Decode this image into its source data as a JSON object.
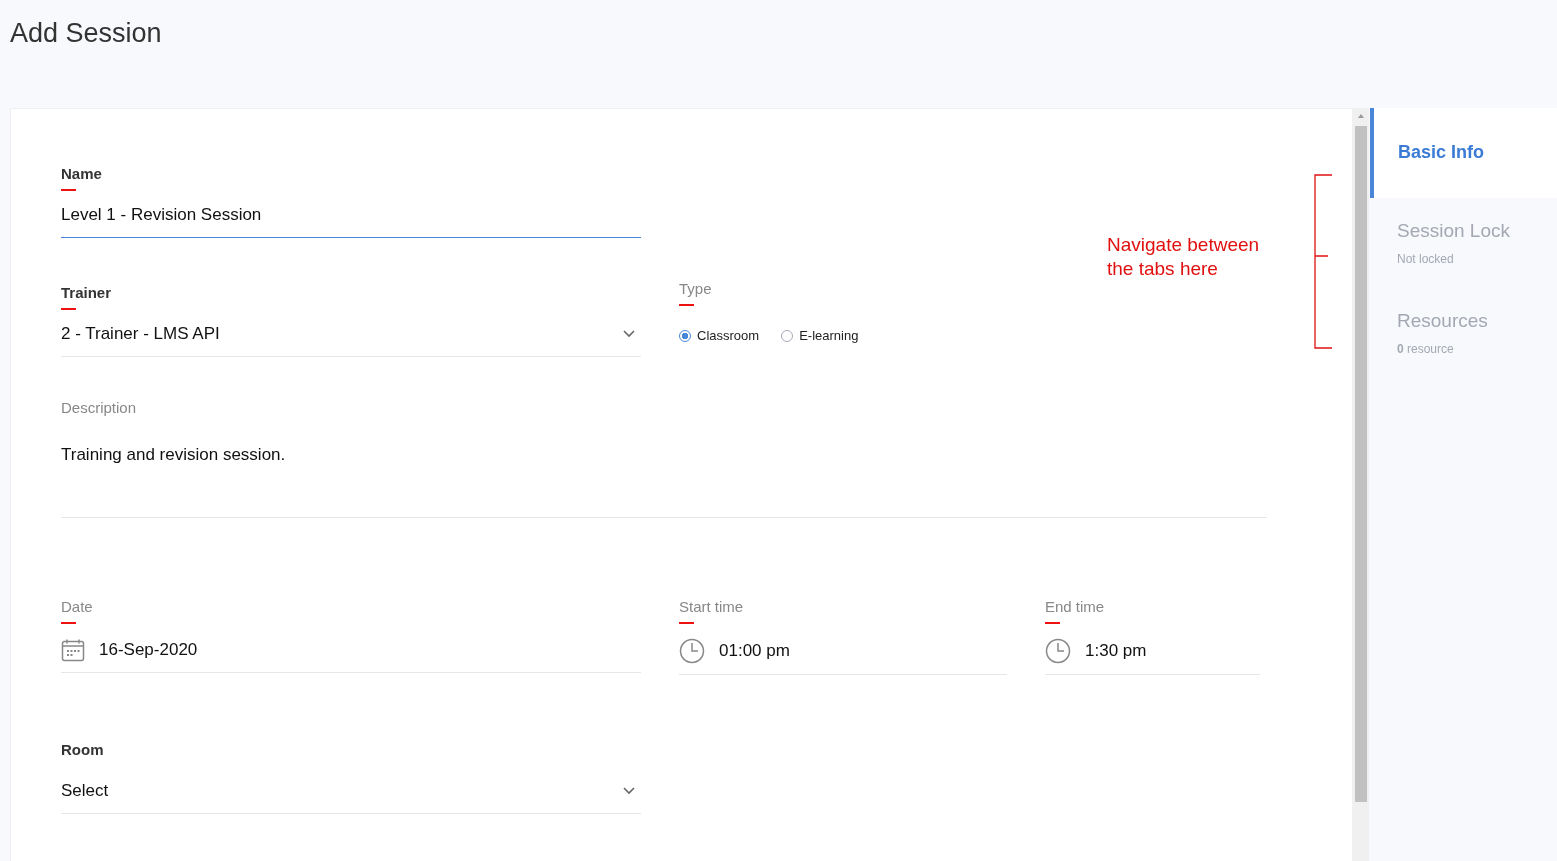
{
  "page": {
    "title": "Add Session"
  },
  "form": {
    "name": {
      "label": "Name",
      "bold": true,
      "required": true,
      "value": "Level 1 - Revision Session",
      "focused": true
    },
    "trainer": {
      "label": "Trainer",
      "bold": true,
      "required": true,
      "value": "2 - Trainer - LMS API"
    },
    "type": {
      "label": "Type",
      "bold": false,
      "required": true,
      "options": [
        {
          "label": "Classroom",
          "selected": true
        },
        {
          "label": "E-learning",
          "selected": false
        }
      ]
    },
    "description": {
      "label": "Description",
      "bold": false,
      "required": false,
      "value": "Training and revision session."
    },
    "date": {
      "label": "Date",
      "bold": false,
      "required": true,
      "value": "16-Sep-2020"
    },
    "start_time": {
      "label": "Start time",
      "bold": false,
      "required": true,
      "value": "01:00 pm"
    },
    "end_time": {
      "label": "End time",
      "bold": false,
      "required": true,
      "value": "1:30 pm"
    },
    "room": {
      "label": "Room",
      "bold": true,
      "required": false,
      "value": "Select"
    }
  },
  "annotation": {
    "text": "Navigate between the tabs here"
  },
  "tabs": [
    {
      "label": "Basic Info",
      "selected": true
    },
    {
      "label": "Session Lock",
      "selected": false,
      "detail": "Not locked"
    },
    {
      "label": "Resources",
      "selected": false,
      "count": "0",
      "detail": "resource"
    }
  ]
}
